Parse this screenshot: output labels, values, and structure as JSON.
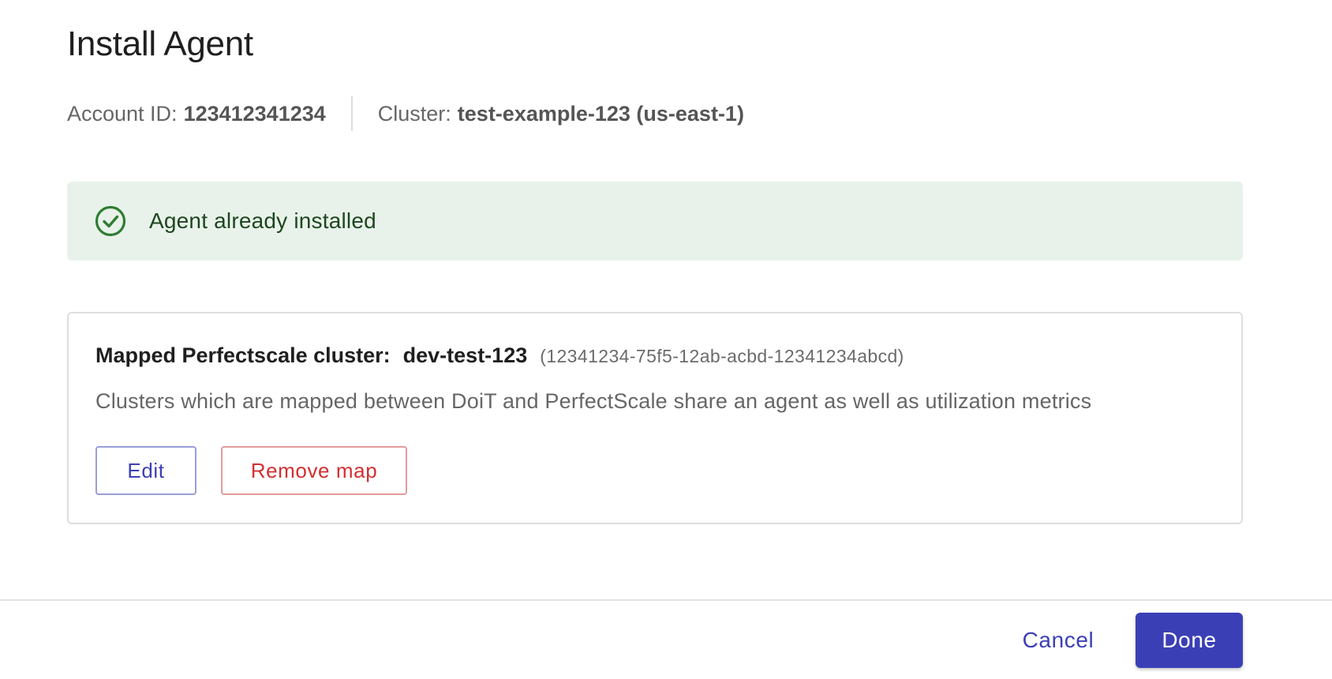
{
  "dialog": {
    "title": "Install Agent"
  },
  "meta": {
    "account_label": "Account ID:",
    "account_value": "123412341234",
    "cluster_label": "Cluster:",
    "cluster_value": "test-example-123 (us-east-1)"
  },
  "alert": {
    "icon": "check-circle-icon",
    "text": "Agent already installed",
    "color": "#2e7d32",
    "background": "#e8f2ea"
  },
  "mapping": {
    "label": "Mapped Perfectscale cluster:",
    "cluster_name": "dev-test-123",
    "cluster_id": "(12341234-75f5-12ab-acbd-12341234abcd)",
    "description": "Clusters which are mapped between DoiT and PerfectScale share an agent as well as utilization metrics",
    "edit_label": "Edit",
    "remove_label": "Remove map"
  },
  "footer": {
    "cancel_label": "Cancel",
    "done_label": "Done"
  },
  "colors": {
    "primary": "#3b3fb6",
    "danger": "#d32f2f",
    "success": "#2e7d32"
  }
}
